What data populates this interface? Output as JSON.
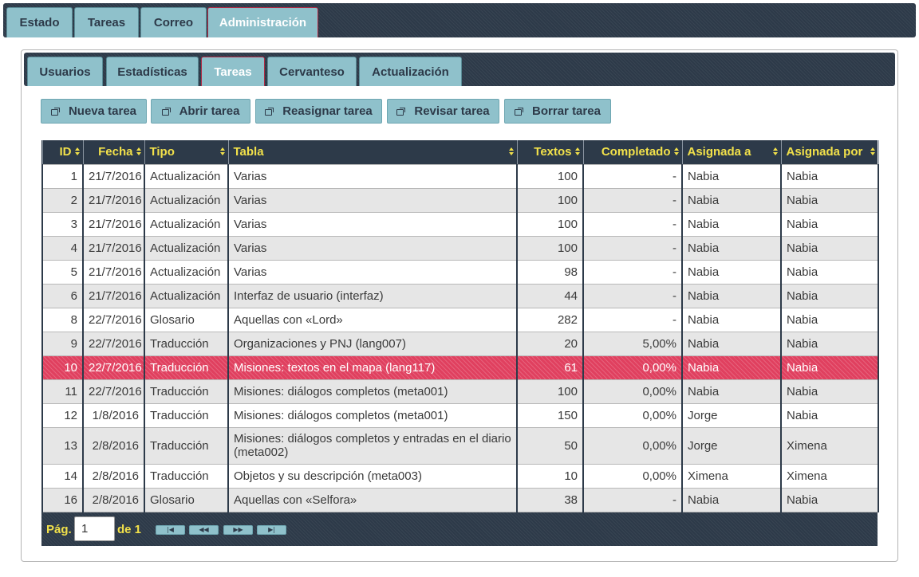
{
  "top_nav": {
    "tabs": [
      {
        "label": "Estado"
      },
      {
        "label": "Tareas"
      },
      {
        "label": "Correo"
      },
      {
        "label": "Administración",
        "active": true
      }
    ]
  },
  "sub_nav": {
    "tabs": [
      {
        "label": "Usuarios"
      },
      {
        "label": "Estadísticas"
      },
      {
        "label": "Tareas",
        "active": true
      },
      {
        "label": "Cervanteso"
      },
      {
        "label": "Actualización"
      }
    ]
  },
  "toolbar": {
    "new_label": "Nueva tarea",
    "open_label": "Abrir tarea",
    "reassign_label": "Reasignar tarea",
    "review_label": "Revisar tarea",
    "delete_label": "Borrar tarea",
    "icon": "external-link-icon"
  },
  "table": {
    "columns": [
      "ID",
      "Fecha",
      "Tipo",
      "Tabla",
      "Textos",
      "Completado",
      "Asignada a",
      "Asignada por"
    ],
    "rows": [
      [
        "1",
        "21/7/2016",
        "Actualización",
        "Varias",
        "100",
        "-",
        "Nabia",
        "Nabia"
      ],
      [
        "2",
        "21/7/2016",
        "Actualización",
        "Varias",
        "100",
        "-",
        "Nabia",
        "Nabia"
      ],
      [
        "3",
        "21/7/2016",
        "Actualización",
        "Varias",
        "100",
        "-",
        "Nabia",
        "Nabia"
      ],
      [
        "4",
        "21/7/2016",
        "Actualización",
        "Varias",
        "100",
        "-",
        "Nabia",
        "Nabia"
      ],
      [
        "5",
        "21/7/2016",
        "Actualización",
        "Varias",
        "98",
        "-",
        "Nabia",
        "Nabia"
      ],
      [
        "6",
        "21/7/2016",
        "Actualización",
        "Interfaz de usuario (interfaz)",
        "44",
        "-",
        "Nabia",
        "Nabia"
      ],
      [
        "8",
        "22/7/2016",
        "Glosario",
        "Aquellas con «Lord»",
        "282",
        "-",
        "Nabia",
        "Nabia"
      ],
      [
        "9",
        "22/7/2016",
        "Traducción",
        "Organizaciones y PNJ (lang007)",
        "20",
        "5,00%",
        "Nabia",
        "Nabia"
      ],
      [
        "10",
        "22/7/2016",
        "Traducción",
        "Misiones: textos en el mapa (lang117)",
        "61",
        "0,00%",
        "Nabia",
        "Nabia"
      ],
      [
        "11",
        "22/7/2016",
        "Traducción",
        "Misiones: diálogos completos (meta001)",
        "100",
        "0,00%",
        "Nabia",
        "Nabia"
      ],
      [
        "12",
        "1/8/2016",
        "Traducción",
        "Misiones: diálogos completos (meta001)",
        "150",
        "0,00%",
        "Jorge",
        "Nabia"
      ],
      [
        "13",
        "2/8/2016",
        "Traducción",
        "Misiones: diálogos completos y entradas en el diario (meta002)",
        "50",
        "0,00%",
        "Jorge",
        "Ximena"
      ],
      [
        "14",
        "2/8/2016",
        "Traducción",
        "Objetos y su descripción (meta003)",
        "10",
        "0,00%",
        "Ximena",
        "Ximena"
      ],
      [
        "16",
        "2/8/2016",
        "Glosario",
        "Aquellas con «Selfora»",
        "38",
        "-",
        "Nabia",
        "Nabia"
      ]
    ],
    "selected_id": "10"
  },
  "pager": {
    "page_label": "Pág.",
    "current_page": "1",
    "of_label": "de 1",
    "first": "|◀",
    "prev": "◀◀",
    "next": "▶▶",
    "last": "▶|"
  },
  "colors": {
    "nav_bg": "#2d3a49",
    "accent": "#e0405f",
    "button": "#8fc1cb",
    "header_text": "#f2e14a"
  }
}
